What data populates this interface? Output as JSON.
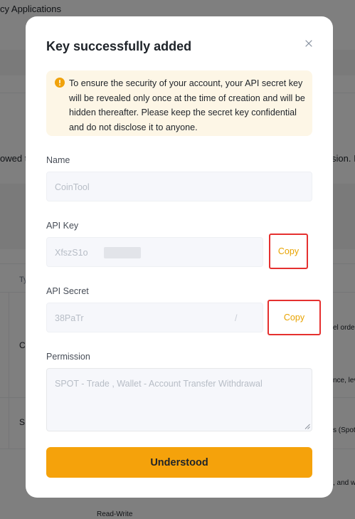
{
  "background": {
    "top_text": "cy Applications",
    "left_snippet": "owed t",
    "right_snippet": "sion. IF",
    "col_header": "Ty",
    "row1_left": "Co",
    "row1_right": "el orde",
    "row2_right": "nce, lev",
    "row3_left": "S",
    "row3_right": "s (Spot)",
    "row4_right": ", and w",
    "bottom_text": "Read-Write"
  },
  "modal": {
    "title": "Key successfully added",
    "close_label": "×",
    "notice": "To ensure the security of your account, your API secret key will be revealed only once at the time of creation and will be hidden thereafter. Please keep the secret key confidential and do not disclose it to anyone.",
    "name": {
      "label": "Name",
      "value": "CoinTool"
    },
    "api_key": {
      "label": "API Key",
      "value": "XfszS1o",
      "copy_label": "Copy"
    },
    "api_secret": {
      "label": "API Secret",
      "value": "38PaTr",
      "tail": "/",
      "copy_label": "Copy"
    },
    "permission": {
      "label": "Permission",
      "value": "SPOT - Trade  , Wallet - Account Transfer Withdrawal"
    },
    "confirm_label": "Understood"
  },
  "colors": {
    "accent": "#f5a20b",
    "copy_text": "#e8a300",
    "highlight_border": "#e5302f",
    "notice_bg": "#fdf6e6"
  }
}
